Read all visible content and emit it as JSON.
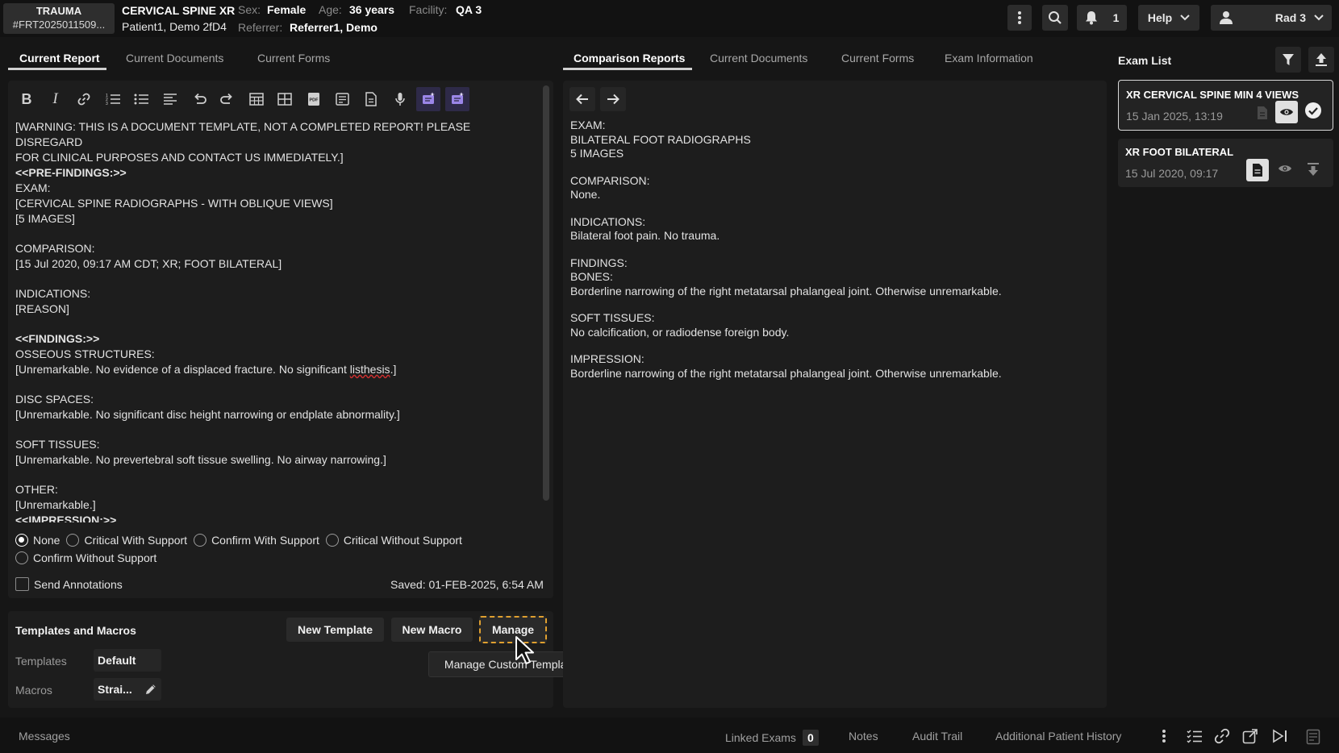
{
  "header": {
    "badge_line1": "TRAUMA",
    "badge_line2": "#FRT2025011509...",
    "exam_title": "CERVICAL SPINE XR",
    "patient_name": "Patient1, Demo 2fD4",
    "sex_label": "Sex:",
    "sex_value": "Female",
    "age_label": "Age:",
    "age_value": "36 years",
    "facility_label": "Facility:",
    "facility_value": "QA 3",
    "referrer_label": "Referrer:",
    "referrer_value": "Referrer1, Demo",
    "notification_count": "1",
    "help_label": "Help",
    "user_label": "Rad 3"
  },
  "left_tabs": [
    "Current Report",
    "Current Documents",
    "Current Forms"
  ],
  "right_tabs": [
    "Comparison Reports",
    "Current Documents",
    "Current Forms",
    "Exam Information"
  ],
  "editor": {
    "lines": [
      {
        "text": "[WARNING: THIS IS A DOCUMENT TEMPLATE, NOT A COMPLETED REPORT! PLEASE DISREGARD",
        "bold": false
      },
      {
        "text": "FOR CLINICAL PURPOSES AND CONTACT US IMMEDIATELY.]",
        "bold": false
      },
      {
        "text": "<<PRE-FINDINGS:>>",
        "bold": true
      },
      {
        "text": "EXAM:",
        "bold": false
      },
      {
        "text": "[CERVICAL SPINE RADIOGRAPHS - WITH OBLIQUE VIEWS]",
        "bold": false
      },
      {
        "text": "[5 IMAGES]",
        "bold": false
      },
      {
        "text": "",
        "bold": false
      },
      {
        "text": "COMPARISON:",
        "bold": false
      },
      {
        "text": "[15 Jul 2020, 09:17 AM CDT; XR; FOOT BILATERAL]",
        "bold": false
      },
      {
        "text": "",
        "bold": false
      },
      {
        "text": "INDICATIONS:",
        "bold": false
      },
      {
        "text": "[REASON]",
        "bold": false
      },
      {
        "text": "",
        "bold": false
      },
      {
        "text": "<<FINDINGS:>>",
        "bold": true
      },
      {
        "text": "OSSEOUS STRUCTURES:",
        "bold": false
      },
      {
        "text": "[Unremarkable. No evidence of a displaced fracture. No significant listhesis.]",
        "bold": false
      },
      {
        "text": "",
        "bold": false
      },
      {
        "text": "DISC SPACES:",
        "bold": false
      },
      {
        "text": "[Unremarkable. No significant disc height narrowing or endplate abnormality.]",
        "bold": false
      },
      {
        "text": "",
        "bold": false
      },
      {
        "text": "SOFT TISSUES:",
        "bold": false
      },
      {
        "text": "[Unremarkable. No prevertebral soft tissue swelling. No airway narrowing.]",
        "bold": false
      },
      {
        "text": "",
        "bold": false
      },
      {
        "text": "OTHER:",
        "bold": false
      },
      {
        "text": "[Unremarkable.]",
        "bold": false
      }
    ]
  },
  "criticality": {
    "options": [
      "None",
      "Critical With Support",
      "Confirm With Support",
      "Critical Without Support",
      "Confirm Without Support"
    ],
    "selected": "None"
  },
  "send_annotations_label": "Send Annotations",
  "saved_text": "Saved: 01-FEB-2025, 6:54 AM",
  "templates": {
    "section_title": "Templates and Macros",
    "new_template_label": "New Template",
    "new_macro_label": "New Macro",
    "manage_label": "Manage",
    "tooltip": "Manage Custom Templates",
    "templates_label": "Templates",
    "templates_value": "Default",
    "macros_label": "Macros",
    "macros_value": "Strai..."
  },
  "comparison": {
    "lines": [
      "EXAM:",
      "BILATERAL FOOT RADIOGRAPHS",
      "5 IMAGES",
      "",
      "COMPARISON:",
      "None.",
      "",
      "INDICATIONS:",
      "Bilateral foot pain. No trauma.",
      "",
      "FINDINGS:",
      "BONES:",
      "Borderline narrowing of the right metatarsal phalangeal joint. Otherwise unremarkable.",
      "",
      "SOFT TISSUES:",
      "No calcification, or radiodense foreign body.",
      "",
      "IMPRESSION:",
      "Borderline narrowing of the right metatarsal phalangeal joint. Otherwise unremarkable."
    ]
  },
  "exam_list": {
    "title": "Exam List",
    "items": [
      {
        "title": "XR CERVICAL SPINE MIN 4 VIEWS",
        "date": "15 Jan 2025, 13:19"
      },
      {
        "title": "XR FOOT BILATERAL",
        "date": "15 Jul 2020, 09:17"
      }
    ]
  },
  "bottom_bar": {
    "messages": "Messages",
    "linked_exams": "Linked Exams",
    "linked_count": "0",
    "notes": "Notes",
    "audit_trail": "Audit Trail",
    "additional_history": "Additional Patient History"
  },
  "colors": {
    "background": "#161616",
    "panel": "#1d1d1d",
    "accent_dashed": "#e0a030",
    "spellcheck": "#d03030"
  }
}
